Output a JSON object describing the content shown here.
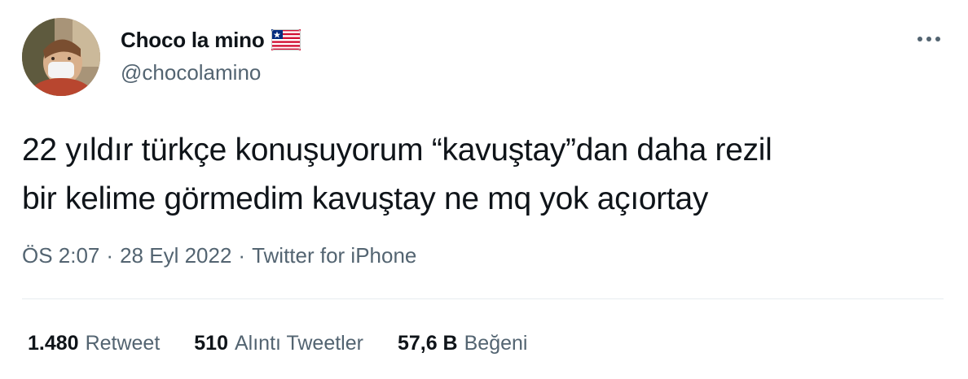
{
  "user": {
    "display_name": "Choco la mino",
    "handle": "@chocolamino",
    "flag_icon": "liberia-flag-icon"
  },
  "tweet": {
    "text": "22 yıldır türkçe konuşuyorum “kavuştay”dan daha rezil\nbir kelime görmedim kavuştay ne mq yok açıortay",
    "time": "ÖS 2:07",
    "separator": "·",
    "date": "28 Eyl 2022",
    "source": "Twitter for iPhone"
  },
  "stats": {
    "retweets": {
      "count": "1.480",
      "label": "Retweet"
    },
    "quotes": {
      "count": "510",
      "label": "Alıntı Tweetler"
    },
    "likes": {
      "count": "57,6 B",
      "label": "Beğeni"
    }
  },
  "colors": {
    "text_primary": "#0f1419",
    "text_secondary": "#536471",
    "divider": "#e6ecf0"
  }
}
